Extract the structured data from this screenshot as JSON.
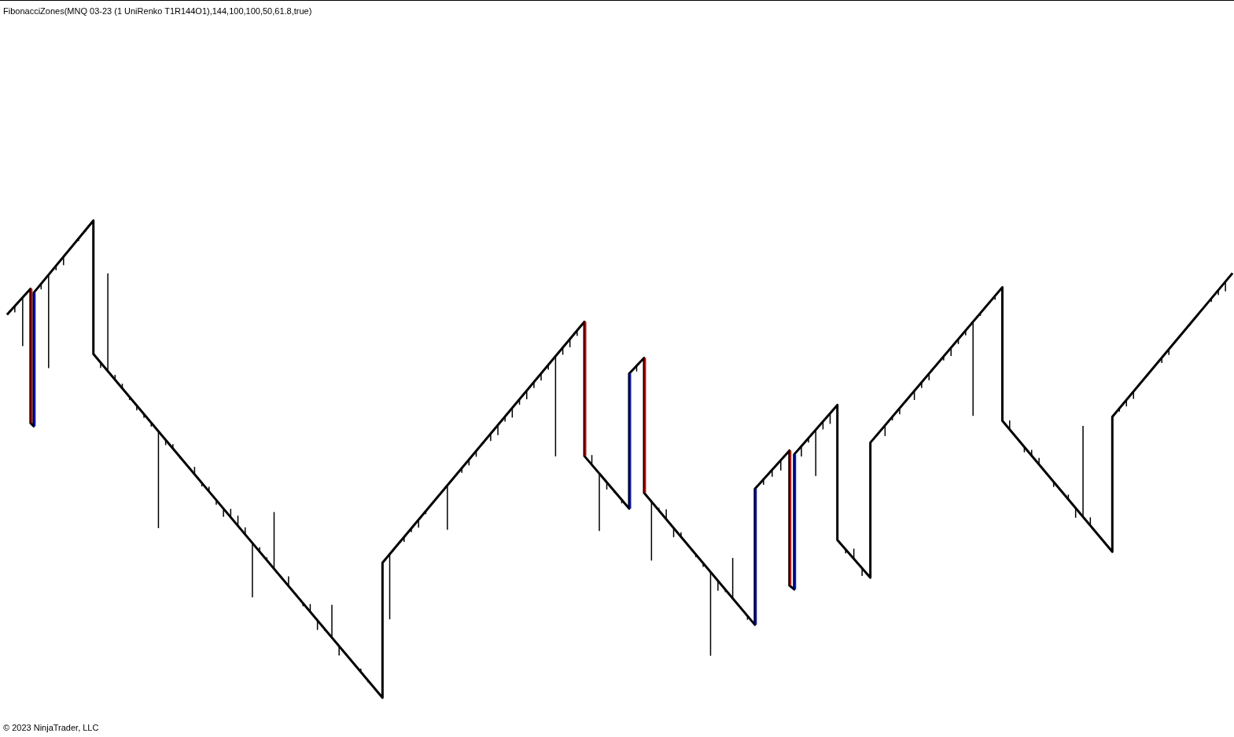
{
  "chart": {
    "title": "FibonacciZones(MNQ 03-23 (1 UniRenko T1R144O1),144,100,100,50,61.8,true)",
    "kind": "picture"
  },
  "footer": {
    "copyright": "© 2023 NinjaTrader, LLC"
  }
}
